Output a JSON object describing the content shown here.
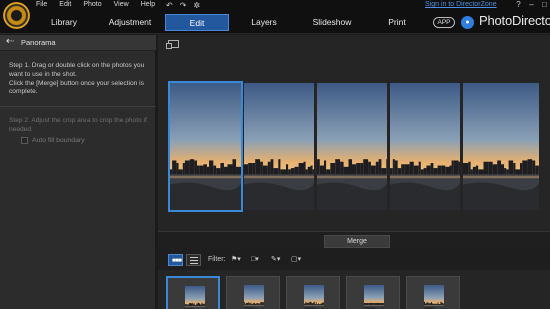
{
  "menu": [
    "File",
    "Edit",
    "Photo",
    "View",
    "Help"
  ],
  "mode_tabs": [
    {
      "label": "Library",
      "active": false
    },
    {
      "label": "Adjustment",
      "active": false
    },
    {
      "label": "Edit",
      "active": true
    },
    {
      "label": "Layers",
      "active": false
    },
    {
      "label": "Slideshow",
      "active": false
    },
    {
      "label": "Print",
      "active": false
    }
  ],
  "header": {
    "signin_link": "Sign in to DirectorZone",
    "app_badge": "APP",
    "brand": "PhotoDirector",
    "window_controls": [
      "?",
      "–",
      "□",
      "✕"
    ],
    "undo_icons": [
      "↶",
      "↷",
      "✲"
    ]
  },
  "panel": {
    "back_icon": "back-arrow-icon",
    "title": "Panorama",
    "step1": "Step 1. Drag or double click on the photos you want to use in the shot.\nClick the [Merge] button once your selection is complete.",
    "step2": "Step 2. Adjust the crop area to crop the photo if needed.",
    "autofill_label": "Auto fill boundary",
    "autofill_checked": false
  },
  "workspace": {
    "panorama_frames": 5,
    "selected_frame": 0
  },
  "merge": {
    "label": "Merge"
  },
  "filter_bar": {
    "filter_label": "Filter:",
    "icons": [
      "flag-filter-icon",
      "frame-filter-icon",
      "edit-filter-icon",
      "color-filter-icon"
    ],
    "view_modes": [
      "thumbnail-view-icon",
      "list-view-icon"
    ]
  },
  "thumbnails": {
    "count": 5,
    "selected_index": 0
  },
  "colors": {
    "accent": "#23579e",
    "selection": "#3a88d8",
    "link": "#4d8fe0",
    "logo": "#e8a61c"
  }
}
